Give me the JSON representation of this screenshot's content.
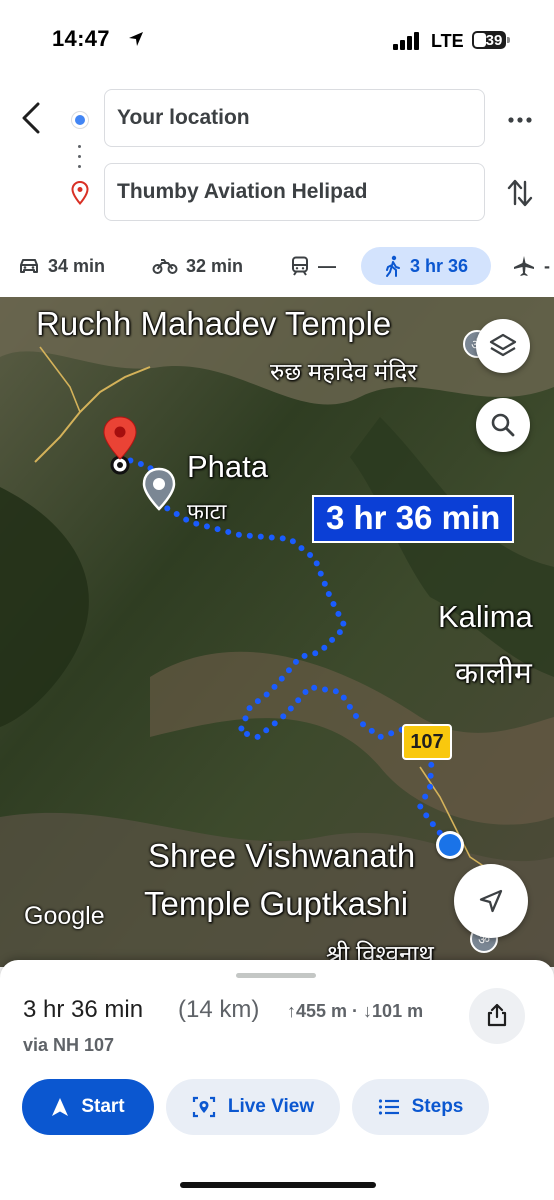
{
  "status_bar": {
    "time": "14:47",
    "network": "LTE",
    "battery": "39"
  },
  "route": {
    "origin": "Your location",
    "destination": "Thumby Aviation Helipad"
  },
  "modes": [
    {
      "icon": "car-icon",
      "label": "34 min"
    },
    {
      "icon": "motorbike-icon",
      "label": "32 min"
    },
    {
      "icon": "train-icon",
      "label": "—"
    },
    {
      "icon": "walk-icon",
      "label": "3 hr 36",
      "selected": true
    },
    {
      "icon": "flight-icon",
      "label": "-"
    }
  ],
  "map": {
    "labels": {
      "ruchh_en": "Ruchh Mahadev Temple",
      "ruchh_hi": "रुछ महादेव मंदिर",
      "phata_en": "Phata",
      "phata_hi": "फाटा",
      "kalima_en": "Kalima",
      "kalima_hi": "कालीम",
      "shree_en_1": "Shree Vishwanath",
      "shree_en_2": "Temple Guptkashi",
      "shree_hi": "श्री विश्वनाथ"
    },
    "duration_callout": "3 hr 36 min",
    "road_shield": "107",
    "attribution": "Google",
    "route_color": "#1a5cff"
  },
  "summary": {
    "duration": "3 hr 36 min",
    "distance": "(14 km)",
    "elevation_up": "455 m",
    "elevation_down": "101 m",
    "via": "via NH 107"
  },
  "actions": {
    "start": "Start",
    "live_view": "Live View",
    "steps": "Steps"
  },
  "colors": {
    "accent": "#0b57d0",
    "chip_bg": "#d3e3fd",
    "map_label": "#ffffff"
  }
}
